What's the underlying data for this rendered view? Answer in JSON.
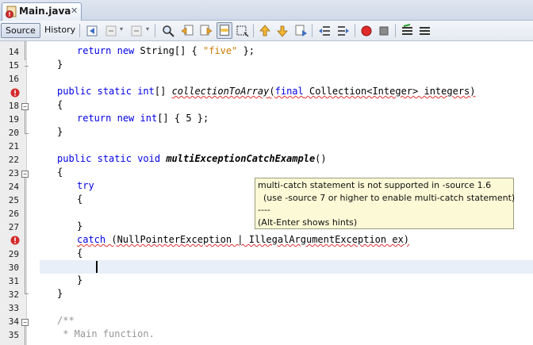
{
  "tab": {
    "title": "Main.java",
    "close": "✕"
  },
  "toolbar": {
    "source_label": "Source",
    "history_label": "History"
  },
  "gutter": {
    "line_numbers": [
      "14",
      "15",
      "16",
      "18",
      "19",
      "20",
      "21",
      "22",
      "23",
      "24",
      "25",
      "26",
      "27",
      "29",
      "30",
      "31",
      "32",
      "33",
      "34",
      "35"
    ]
  },
  "code": {
    "l14a": "return",
    "l14b": " ",
    "l14c": "new",
    "l14d": " String[] { ",
    "l14e": "\"five\"",
    "l14f": " };",
    "l15": "}",
    "l18a": "public",
    "l18b": " ",
    "l18c": "static",
    "l18d": " ",
    "l18e": "int",
    "l18f": "[] ",
    "l18g": "collectionToArray",
    "l18h": "(",
    "l18i": "final",
    "l18j": " Collection<Integer> integers)",
    "l19": "{",
    "l20a": "return",
    "l20b": " ",
    "l20c": "new",
    "l20d": " ",
    "l20e": "int",
    "l20f": "[] { 5 };",
    "l21": "}",
    "l23a": "public",
    "l23b": " ",
    "l23c": "static",
    "l23d": " ",
    "l23e": "void",
    "l23f": " ",
    "l23g": "multiExceptionCatchExample",
    "l23h": "()",
    "l24": "{",
    "l25": "try",
    "l26": "{",
    "l27": "}",
    "l29a": "catch",
    "l29b": " (NullPointerException | IllegalArgumentException ex)",
    "l30": "{",
    "l32": "}",
    "l33": "}",
    "l34": "/**",
    "l35": " * Main function."
  },
  "tooltip": {
    "line1": "multi-catch statement is not supported in -source 1.6",
    "line2": "  (use -source 7 or higher to enable multi-catch statement)",
    "line3": "----",
    "line4": "(Alt-Enter shows hints)"
  }
}
